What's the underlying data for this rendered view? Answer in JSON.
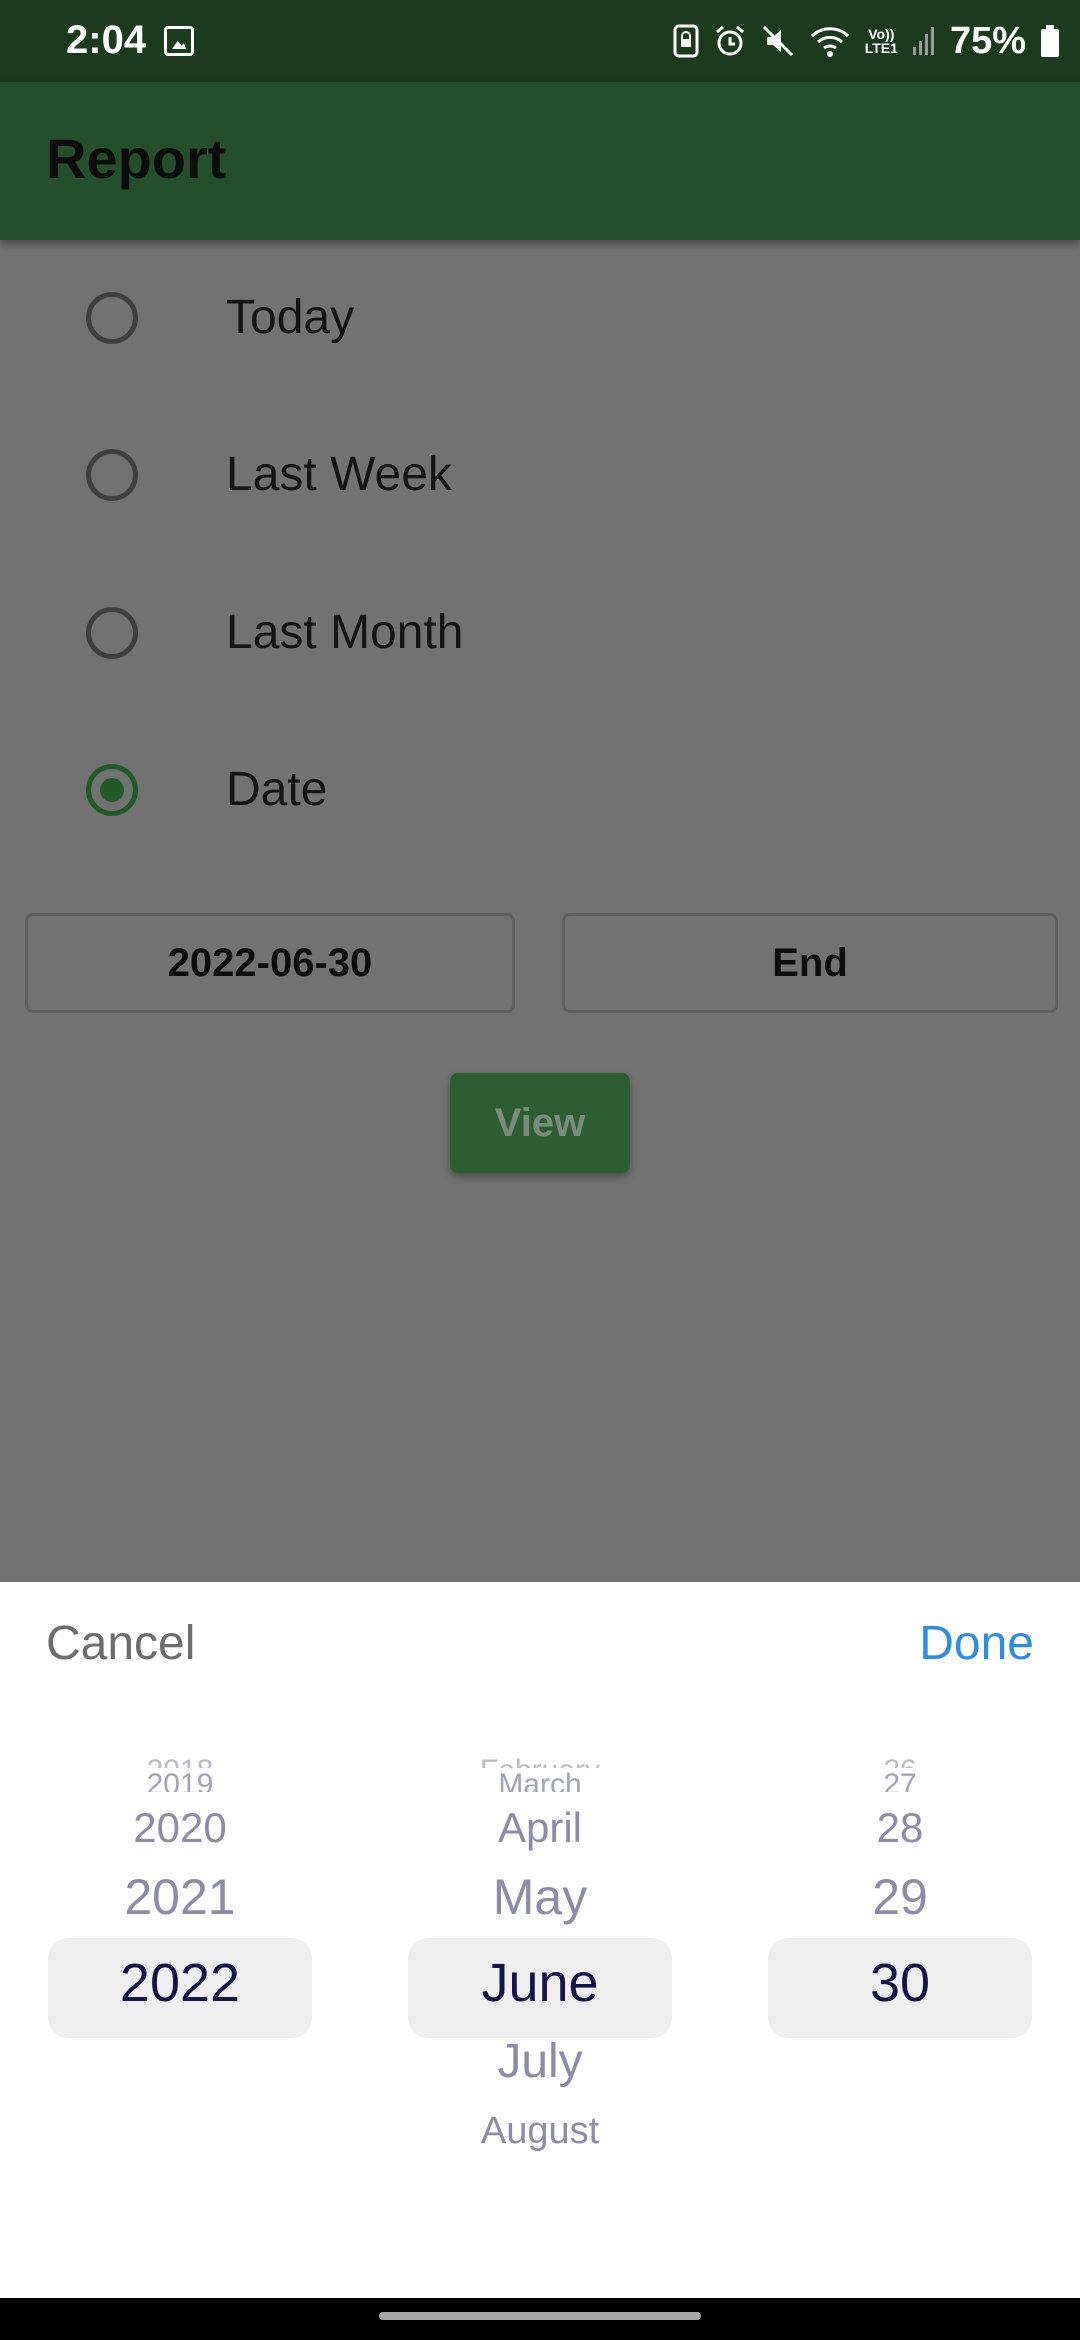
{
  "status_bar": {
    "time": "2:04",
    "network_top": "Vo))",
    "network_bottom": "LTE1",
    "battery": "75%",
    "icons": [
      "image-icon",
      "lock-rotate-icon",
      "alarm-icon",
      "mute-icon",
      "wifi-icon",
      "signal-icon",
      "battery-icon"
    ]
  },
  "app_bar": {
    "title": "Report"
  },
  "options": [
    {
      "label": "Today",
      "selected": false
    },
    {
      "label": "Last Week",
      "selected": false
    },
    {
      "label": "Last Month",
      "selected": false
    },
    {
      "label": "Date",
      "selected": true
    }
  ],
  "date_range": {
    "start": "2022-06-30",
    "end": "End"
  },
  "view_button": "View",
  "picker": {
    "cancel": "Cancel",
    "done": "Done",
    "years": {
      "faded_top": "2018",
      "above_2": "2019",
      "above_1": "2020",
      "above_0": "2021",
      "selected": "2022",
      "below_1": "",
      "below_2": ""
    },
    "months": {
      "faded_top": "February",
      "above_2": "March",
      "above_1": "April",
      "above_0": "May",
      "selected": "June",
      "below_1": "July",
      "below_2": "August"
    },
    "days": {
      "faded_top": "26",
      "above_2": "27",
      "above_1": "28",
      "above_0": "29",
      "selected": "30",
      "below_1": "",
      "below_2": ""
    }
  },
  "colors": {
    "status_bar": "#1b3a1e",
    "app_bar": "#23502a",
    "scrim": "#727272",
    "accent": "#215a26",
    "done": "#2f8de0"
  }
}
